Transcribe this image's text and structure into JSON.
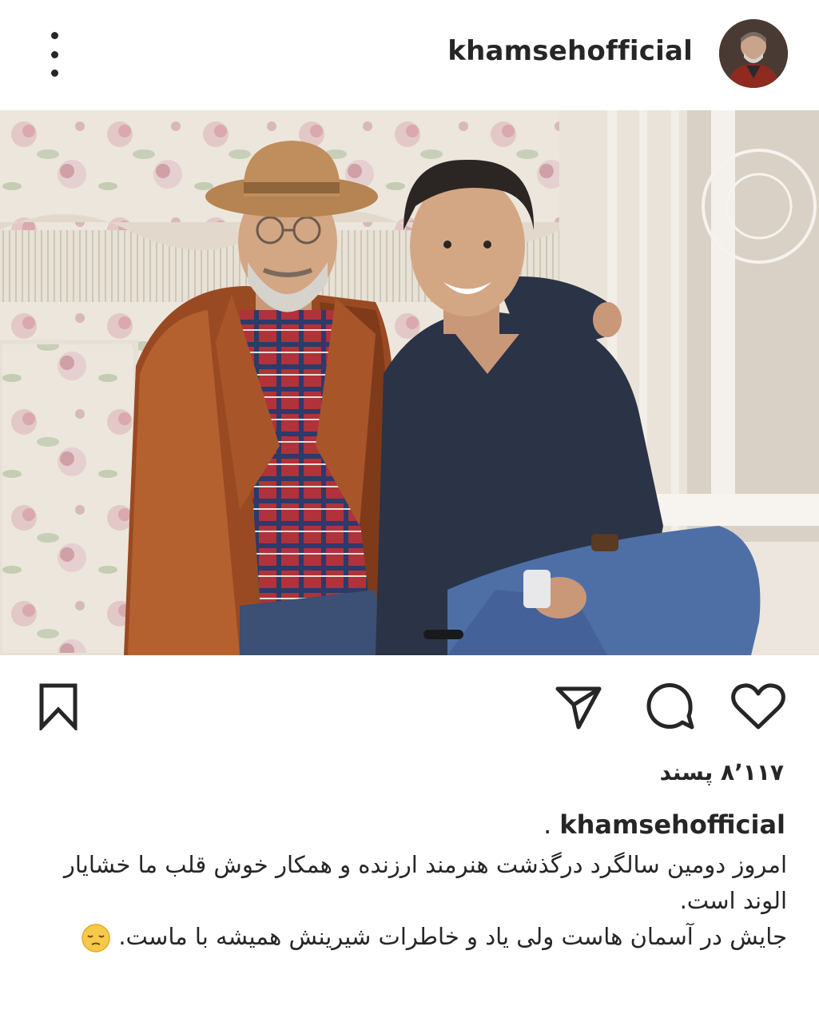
{
  "header": {
    "username": "khamsehofficial",
    "menu_icon": "more-vertical-icon",
    "avatar_icon": "profile-avatar"
  },
  "post": {
    "photo_icon": "post-photo"
  },
  "actions": {
    "like_icon": "heart-icon",
    "comment_icon": "comment-icon",
    "share_icon": "send-icon",
    "save_icon": "bookmark-icon"
  },
  "likes": {
    "text": "۸٬۱۱۷ پسند"
  },
  "caption": {
    "username": "khamsehofficial",
    "separator": ".",
    "line1": "امروز دومین سالگرد درگذشت هنرمند ارزنده و همکار خوش قلب ما خشایار الوند است.",
    "line2": "جایش در آسمان هاست ولی یاد و خاطرات شیرینش همیشه با ماست.",
    "emoji": "pensive-face-emoji"
  }
}
